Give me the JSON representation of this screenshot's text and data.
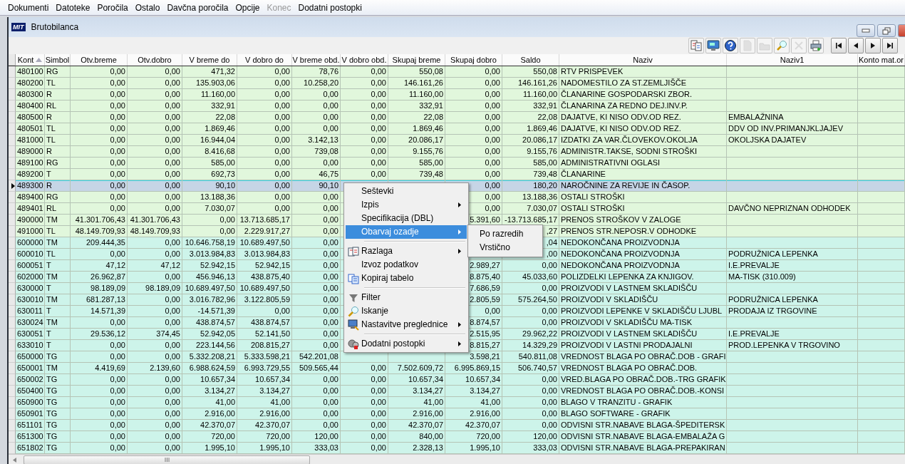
{
  "menu_bar": [
    {
      "label": "Dokumenti",
      "disabled": false
    },
    {
      "label": "Datoteke",
      "disabled": false
    },
    {
      "label": "Poročila",
      "disabled": false
    },
    {
      "label": "Ostalo",
      "disabled": false
    },
    {
      "label": "Davčna poročila",
      "disabled": false
    },
    {
      "label": "Opcije",
      "disabled": false
    },
    {
      "label": "Konec",
      "disabled": true
    },
    {
      "label": "Dodatni postopki",
      "disabled": false
    }
  ],
  "window": {
    "logo": "MIT",
    "title": "Brutobilanca"
  },
  "toolbar": [
    {
      "kind": "split-doc",
      "disabled": false
    },
    {
      "kind": "monitor",
      "disabled": false
    },
    {
      "kind": "help",
      "disabled": false
    },
    {
      "kind": "new",
      "disabled": true
    },
    {
      "kind": "open",
      "disabled": true
    },
    {
      "kind": "search",
      "disabled": false
    },
    {
      "kind": "delete",
      "disabled": true
    },
    {
      "kind": "print",
      "disabled": false
    },
    {
      "kind": "first",
      "disabled": false
    },
    {
      "kind": "prev",
      "disabled": false
    },
    {
      "kind": "next",
      "disabled": false
    },
    {
      "kind": "last",
      "disabled": false
    }
  ],
  "table": {
    "columns": [
      {
        "label": "Kont",
        "sorted": true
      },
      {
        "label": "Simbol",
        "sorted": false
      },
      {
        "label": "Otv.breme",
        "sorted": false
      },
      {
        "label": "Otv.dobro",
        "sorted": false
      },
      {
        "label": "V breme do",
        "sorted": false
      },
      {
        "label": "V dobro do",
        "sorted": false
      },
      {
        "label": "V breme obd.",
        "sorted": false
      },
      {
        "label": "V dobro obd.",
        "sorted": false
      },
      {
        "label": "Skupaj breme",
        "sorted": false
      },
      {
        "label": "Skupaj dobro",
        "sorted": false
      },
      {
        "label": "Saldo",
        "sorted": false
      },
      {
        "label": "Naziv",
        "sorted": false
      },
      {
        "label": "Naziv1",
        "sorted": false
      },
      {
        "label": "Konto mat.or",
        "sorted": false
      }
    ],
    "rows": [
      {
        "selected": false,
        "color": "#e1f7dc",
        "cells": [
          "480100",
          "RG",
          "0,00",
          "0,00",
          "471,32",
          "0,00",
          "78,76",
          "0,00",
          "550,08",
          "0,00",
          "550,08",
          "RTV PRISPEVEK",
          null
        ]
      },
      {
        "selected": false,
        "color": "#e1f7dc",
        "cells": [
          "480200",
          "TL",
          "0,00",
          "0,00",
          "135.903,06",
          "0,00",
          "10.258,20",
          "0,00",
          "146.161,26",
          "0,00",
          "146.161,26",
          "NADOMESTILO ZA ST.ZEMLJIŠČE",
          null
        ]
      },
      {
        "selected": false,
        "color": "#e1f7dc",
        "cells": [
          "480300",
          "R",
          "0,00",
          "0,00",
          "11.160,00",
          "0,00",
          "0,00",
          "0,00",
          "11.160,00",
          "0,00",
          "11.160,00",
          "ČLANARINE GOSPODARSKI ZBOR.",
          null
        ]
      },
      {
        "selected": false,
        "color": "#e1f7dc",
        "cells": [
          "480400",
          "RL",
          "0,00",
          "0,00",
          "332,91",
          "0,00",
          "0,00",
          "0,00",
          "332,91",
          "0,00",
          "332,91",
          "ČLANARINA ZA REDNO DEJ.INV.P.",
          null
        ]
      },
      {
        "selected": false,
        "color": "#e1f7dc",
        "cells": [
          "480500",
          "R",
          "0,00",
          "0,00",
          "22,08",
          "0,00",
          "0,00",
          "0,00",
          "22,08",
          "0,00",
          "22,08",
          "DAJATVE, KI NISO ODV.OD REZ.",
          "EMBALAŽNINA"
        ]
      },
      {
        "selected": false,
        "color": "#e1f7dc",
        "cells": [
          "480501",
          "TL",
          "0,00",
          "0,00",
          "1.869,46",
          "0,00",
          "0,00",
          "0,00",
          "1.869,46",
          "0,00",
          "1.869,46",
          "DAJATVE, KI NISO ODV.OD REZ.",
          "DDV OD INV.PRIMANJKLJAJEV"
        ]
      },
      {
        "selected": false,
        "color": "#e1f7dc",
        "cells": [
          "481000",
          "TL",
          "0,00",
          "0,00",
          "16.944,04",
          "0,00",
          "3.142,13",
          "0,00",
          "20.086,17",
          "0,00",
          "20.086,17",
          "IZDATKI ZA VAR.ČLOVEKOV.OKOLJA",
          "OKOLJSKA DAJATEV"
        ]
      },
      {
        "selected": false,
        "color": "#e1f7dc",
        "cells": [
          "489000",
          "R",
          "0,00",
          "0,00",
          "8.416,68",
          "0,00",
          "739,08",
          "0,00",
          "9.155,76",
          "0,00",
          "9.155,76",
          "ADMINISTR.TAKSE, SODNI STROŠKI",
          null
        ]
      },
      {
        "selected": false,
        "color": "#e1f7dc",
        "cells": [
          "489100",
          "RG",
          "0,00",
          "0,00",
          "585,00",
          "0,00",
          "0,00",
          "0,00",
          "585,00",
          "0,00",
          "585,00",
          "ADMINISTRATIVNI OGLASI",
          null
        ]
      },
      {
        "selected": false,
        "color": "#e1f7dc",
        "cells": [
          "489200",
          "T",
          "0,00",
          "0,00",
          "692,73",
          "0,00",
          "46,75",
          "0,00",
          "739,48",
          "0,00",
          "739,48",
          "ČLANARINE",
          null
        ]
      },
      {
        "selected": true,
        "cells": [
          "489300",
          "R",
          "0,00",
          "0,00",
          "90,10",
          "0,00",
          "90,10",
          null,
          null,
          "0,00",
          "180,20",
          "NAROČNINE ZA REVIJE IN ČASOP.",
          null
        ]
      },
      {
        "selected": false,
        "color": "#e1f7dc",
        "cells": [
          "489400",
          "RG",
          "0,00",
          "0,00",
          "13.188,36",
          "0,00",
          "0,00",
          null,
          null,
          "0,00",
          "13.188,36",
          "OSTALI STROŠKI",
          null
        ]
      },
      {
        "selected": false,
        "color": "#e1f7dc",
        "cells": [
          "489401",
          "RL",
          "0,00",
          "0,00",
          "7.030,07",
          "0,00",
          "0,00",
          null,
          null,
          "0,00",
          "7.030,07",
          "OSTALI STROŠKI",
          "DAVČNO NEPRIZNAN ODHODEK"
        ]
      },
      {
        "selected": false,
        "color": "#e1f7dc",
        "cells": [
          "490000",
          "TM",
          "41.301.706,43",
          "41.301.706,43",
          "0,00",
          "13.713.685,17",
          "0,00",
          null,
          null,
          "5.391,60",
          "-13.713.685,17",
          "PRENOS STROŠKOV V ZALOGE",
          null
        ]
      },
      {
        "selected": false,
        "color": "#e1f7dc",
        "cells": [
          "491000",
          "TL",
          "48.149.709,93",
          "48.149.709,93",
          "0,00",
          "2.229.917,27",
          "0,00",
          null,
          null,
          null,
          ",27",
          "PRENOS STR.NEPOSR.V ODHODKE",
          null
        ]
      },
      {
        "selected": false,
        "color": "#cdf4ea",
        "cells": [
          "600000",
          "TM",
          "209.444,35",
          "0,00",
          "10.646.758,19",
          "10.689.497,50",
          "0,00",
          null,
          null,
          null,
          ",04",
          "NEDOKONČANA PROIZVODNJA",
          null
        ]
      },
      {
        "selected": false,
        "color": "#cdf4ea",
        "cells": [
          "600010",
          "TL",
          "0,00",
          "0,00",
          "3.013.984,83",
          "3.013.984,83",
          "0,00",
          null,
          null,
          null,
          ",00",
          "NEDOKONČANA PROIZVODNJA",
          "PODRUŽNICA LEPENKA"
        ]
      },
      {
        "selected": false,
        "color": "#cdf4ea",
        "cells": [
          "600051",
          "T",
          "47,12",
          "47,12",
          "52.942,15",
          "52.942,15",
          "0,00",
          null,
          null,
          "2.989,27",
          "0,00",
          "NEDOKONČANA PROIZVODNJA",
          "I.E.PREVALJE"
        ]
      },
      {
        "selected": false,
        "color": "#cdf4ea",
        "cells": [
          "602000",
          "TM",
          "26.962,87",
          "0,00",
          "456.946,13",
          "438.875,40",
          "0,00",
          null,
          null,
          "8.875,40",
          "45.033,60",
          "POLIZDELKI LEPENKA ZA KNJIGOV.",
          "MA-TISK (310.009)"
        ]
      },
      {
        "selected": false,
        "color": "#cdf4ea",
        "cells": [
          "630000",
          "T",
          "98.189,09",
          "98.189,09",
          "10.689.497,50",
          "10.689.497,50",
          "0,00",
          null,
          null,
          "7.686,59",
          "0,00",
          "PROIZVODI V LASTNEM SKLADIŠČU",
          null
        ]
      },
      {
        "selected": false,
        "color": "#cdf4ea",
        "cells": [
          "630010",
          "TM",
          "681.287,13",
          "0,00",
          "3.016.782,96",
          "3.122.805,59",
          "0,00",
          null,
          null,
          "2.805,59",
          "575.264,50",
          "PROIZVODI V SKLADIŠČU",
          "PODRUŽNICA LEPENKA"
        ]
      },
      {
        "selected": false,
        "color": "#cdf4ea",
        "cells": [
          "630011",
          "T",
          "14.571,39",
          "0,00",
          "-14.571,39",
          "0,00",
          "0,00",
          null,
          null,
          "0,00",
          "0,00",
          "PROIZVODI LEPENKE V  SKLADIŠČU LJUBL",
          "PRODAJA IZ TRGOVINE"
        ]
      },
      {
        "selected": false,
        "color": "#cdf4ea",
        "cells": [
          "630024",
          "TM",
          "0,00",
          "0,00",
          "438.874,57",
          "438.874,57",
          "0,00",
          null,
          null,
          "8.874,57",
          "0,00",
          "PROIZVODI V SKLADIŠČU MA-TISK",
          null
        ]
      },
      {
        "selected": false,
        "color": "#cdf4ea",
        "cells": [
          "630051",
          "T",
          "29.536,12",
          "374,45",
          "52.942,05",
          "52.141,50",
          "0,00",
          null,
          null,
          "2.515,95",
          "29.962,22",
          "PROIZVODI V LASTNEM SKLADIŠČU",
          "I.E.PREVALJE"
        ]
      },
      {
        "selected": false,
        "color": "#cdf4ea",
        "cells": [
          "633010",
          "T",
          "0,00",
          "0,00",
          "223.144,56",
          "208.815,27",
          "0,00",
          null,
          null,
          "8.815,27",
          "14.329,29",
          "PROIZVODI V LASTNI PRODAJALNI",
          "PROD.LEPENKA V TRGOVINO"
        ]
      },
      {
        "selected": false,
        "color": "#cdf4ea",
        "cells": [
          "650000",
          "TG",
          "0,00",
          "0,00",
          "5.332.208,21",
          "5.333.598,21",
          "542.201,08",
          null,
          null,
          "3.598,21",
          "540.811,08",
          "VREDNOST BLAGA PO OBRAČ.DOB - GRAFI",
          null
        ]
      },
      {
        "selected": false,
        "color": "#cdf4ea",
        "cells": [
          "650001",
          "TM",
          "4.419,69",
          "2.139,60",
          "6.988.624,59",
          "6.993.729,55",
          "509.565,44",
          "0,00",
          "7.502.609,72",
          "6.995.869,15",
          "506.740,57",
          "VREDNOST BLAGA PO OBRAČ.DOB.",
          null
        ]
      },
      {
        "selected": false,
        "color": "#cdf4ea",
        "cells": [
          "650002",
          "TG",
          "0,00",
          "0,00",
          "10.657,34",
          "10.657,34",
          "0,00",
          "0,00",
          "10.657,34",
          "10.657,34",
          "0,00",
          "VRED.BLAGA PO OBRAČ.DOB.-TRG  GRAFIK",
          null
        ]
      },
      {
        "selected": false,
        "color": "#cdf4ea",
        "cells": [
          "650400",
          "TG",
          "0,00",
          "0,00",
          "3.134,27",
          "3.134,27",
          "0,00",
          "0,00",
          "3.134,27",
          "3.134,27",
          "0,00",
          "VREDNOST BLAGA PO OBRAČ.DOB.-KONSI",
          null
        ]
      },
      {
        "selected": false,
        "color": "#cdf4ea",
        "cells": [
          "650900",
          "TG",
          "0,00",
          "0,00",
          "41,00",
          "41,00",
          "0,00",
          "0,00",
          "41,00",
          "41,00",
          "0,00",
          "BLAGO V TRANZITU - GRAFIK",
          null
        ]
      },
      {
        "selected": false,
        "color": "#cdf4ea",
        "cells": [
          "650901",
          "TG",
          "0,00",
          "0,00",
          "2.916,00",
          "2.916,00",
          "0,00",
          "0,00",
          "2.916,00",
          "2.916,00",
          "0,00",
          "BLAGO SOFTWARE - GRAFIK",
          null
        ]
      },
      {
        "selected": false,
        "color": "#cdf4ea",
        "cells": [
          "651101",
          "TG",
          "0,00",
          "0,00",
          "42.370,07",
          "42.370,07",
          "0,00",
          "0,00",
          "42.370,07",
          "42.370,07",
          "0,00",
          "ODVISNI STR.NABAVE BLAGA-ŠPEDITERSK",
          null
        ]
      },
      {
        "selected": false,
        "color": "#cdf4ea",
        "cells": [
          "651300",
          "TG",
          "0,00",
          "0,00",
          "720,00",
          "720,00",
          "120,00",
          "0,00",
          "840,00",
          "720,00",
          "120,00",
          "ODVISNI STR.NABAVE BLAGA-EMBALAŽA G",
          null
        ]
      },
      {
        "selected": false,
        "color": "#cdf4ea",
        "cells": [
          "651802",
          "TG",
          "0,00",
          "0,00",
          "1.995,10",
          "1.995,10",
          "333,03",
          "0,00",
          "2.328,13",
          "1.995,10",
          "333,03",
          "ODVISNI STR.NABAVE BLAGA-PREPAKIRAN",
          null
        ]
      }
    ]
  },
  "context_menu": {
    "items": [
      {
        "kind": "command",
        "label": "Seštevki",
        "submenu": false,
        "selected": false
      },
      {
        "kind": "command",
        "label": "Izpis",
        "submenu": true,
        "selected": false
      },
      {
        "kind": "command",
        "label": "Specifikacija (DBL)",
        "submenu": false,
        "selected": false
      },
      {
        "kind": "command",
        "label": "Obarvaj ozadje",
        "submenu": true,
        "selected": true
      },
      {
        "kind": "separator"
      },
      {
        "kind": "command",
        "label": "Razlaga",
        "submenu": true,
        "selected": false
      },
      {
        "kind": "command",
        "label": "Izvoz podatkov",
        "submenu": false,
        "selected": false
      },
      {
        "kind": "command",
        "label": "Kopiraj tabelo",
        "submenu": false,
        "selected": false
      },
      {
        "kind": "separator"
      },
      {
        "kind": "command",
        "label": "Filter",
        "submenu": false,
        "selected": false
      },
      {
        "kind": "command",
        "label": "Iskanje",
        "submenu": false,
        "selected": false
      },
      {
        "kind": "command",
        "label": "Nastavitve preglednice",
        "submenu": true,
        "selected": false
      },
      {
        "kind": "separator"
      },
      {
        "kind": "command",
        "label": "Dodatni postopki",
        "submenu": true,
        "selected": false
      }
    ],
    "submenu": [
      {
        "label": "Po razredih",
        "selected": false
      },
      {
        "label": "Vrstično",
        "selected": false
      }
    ]
  }
}
